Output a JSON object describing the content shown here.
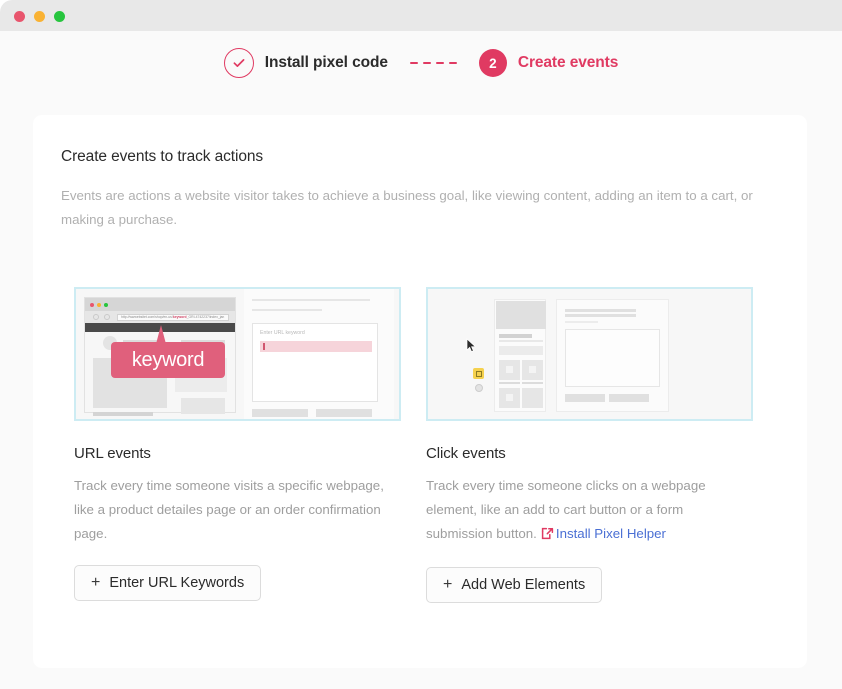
{
  "window": {
    "traffic_lights": [
      {
        "name": "close",
        "color": "#e8556d"
      },
      {
        "name": "minimize",
        "color": "#f9b233"
      },
      {
        "name": "maximize",
        "color": "#27c53e"
      }
    ]
  },
  "stepper": {
    "step1": {
      "label": "Install pixel code",
      "state": "completed",
      "icon": "check-icon"
    },
    "connector_dashes": 4,
    "step2": {
      "number": "2",
      "label": "Create events",
      "state": "active"
    },
    "accent_color": "#e03a62"
  },
  "card": {
    "title": "Create events to track actions",
    "description": "Events are actions a website visitor takes to achieve a business goal, like viewing content, adding an item to a cart, or making a purchase.",
    "columns": [
      {
        "key": "url_events",
        "title": "URL events",
        "description": "Track every time someone visits a specific webpage, like a product detailes page or an order confirmation page.",
        "button": {
          "label": "Enter URL Keywords",
          "prefix": "+"
        },
        "thumbnail": {
          "alt": "browser window with pink keyword callout and enter URL keyword dialog",
          "border_color": "#cdecf3",
          "callout_text": "keyword",
          "callout_color": "#e0607c",
          "url_text_prefix": "http://wwwebsitet.com/shop/en-us/",
          "url_text_highlight": "keyword",
          "url_text_suffix": "_GRI-4742237/index_jan",
          "dialog_label": "Enter URL keyword"
        }
      },
      {
        "key": "click_events",
        "title": "Click events",
        "description": "Track every time someone clicks on a webpage element, like an add to cart button or a form submission button.",
        "link": {
          "label": "Install Pixel Helper",
          "icon": "external-link-icon",
          "color": "#4a6fd4",
          "icon_color": "#e03a62"
        },
        "button": {
          "label": "Add Web Elements",
          "prefix": "+"
        },
        "thumbnail": {
          "alt": "grayscale wireframe page with mouse cursor clicking an element and yellow badge",
          "border_color": "#cdecf3",
          "badge_color": "#f5d14e"
        }
      }
    ]
  }
}
